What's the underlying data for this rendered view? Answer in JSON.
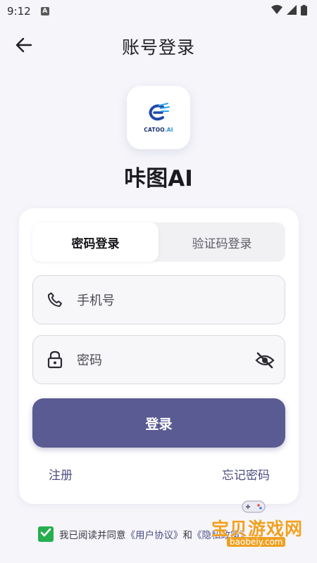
{
  "status_bar": {
    "time": "9:12",
    "badge": "A"
  },
  "header": {
    "title": "账号登录",
    "back_icon": "arrow-left-icon"
  },
  "logo": {
    "brand": "CATOO",
    "brand_suffix": ".AI"
  },
  "app_name": "咔图AI",
  "tabs": [
    {
      "label": "密码登录",
      "active": true
    },
    {
      "label": "验证码登录",
      "active": false
    }
  ],
  "phone_field": {
    "placeholder": "手机号",
    "icon": "phone-icon"
  },
  "password_field": {
    "placeholder": "密码",
    "icon": "lock-icon",
    "toggle_icon": "eye-off-icon"
  },
  "login_button": "登录",
  "links": {
    "register": "注册",
    "forgot": "忘记密码"
  },
  "agreement": {
    "checked": true,
    "prefix": "我已阅读并同意",
    "user_agreement": "《用户协议》",
    "and": "和",
    "privacy_policy": "《隐私政策》"
  },
  "watermark": {
    "text": "宝贝游戏网",
    "url": "baobeiy.com"
  },
  "colors": {
    "primary": "#5b5b93",
    "checkbox": "#27ae4f",
    "background": "#f5f5fa",
    "watermark": "#f2a020"
  }
}
